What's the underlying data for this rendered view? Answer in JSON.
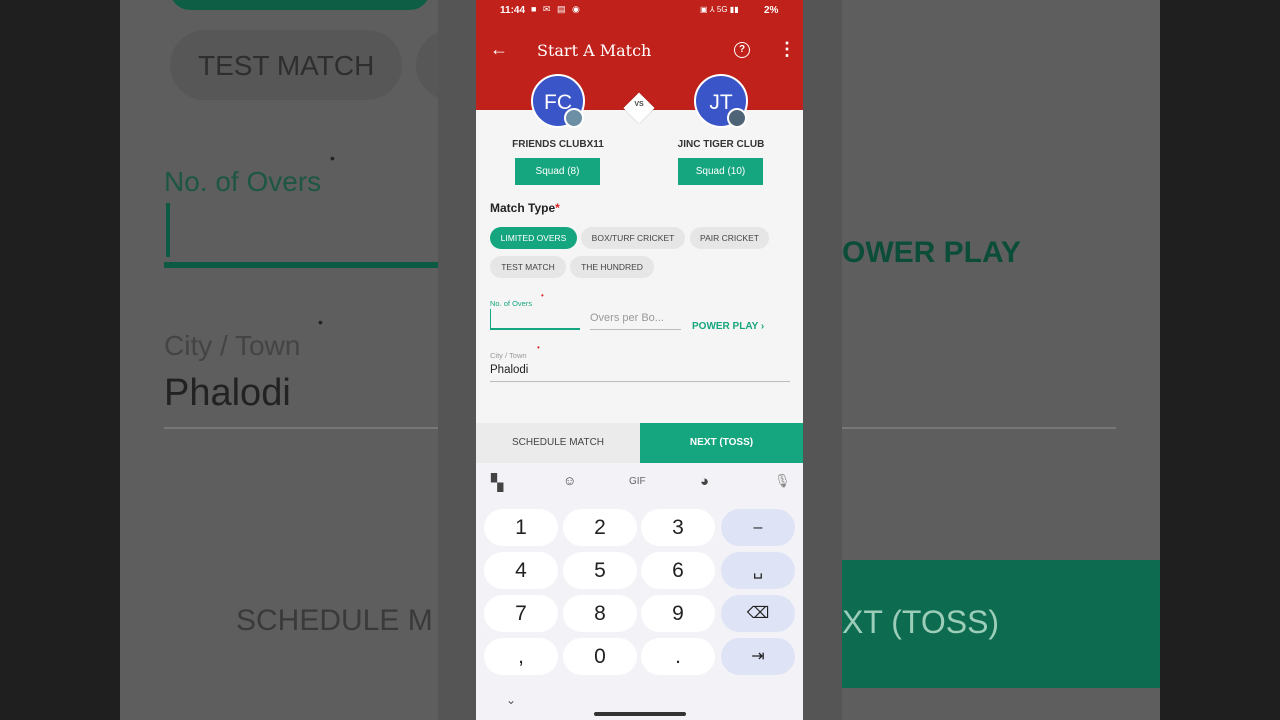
{
  "background": {
    "test_match": "TEST MATCH",
    "no_of_overs": "No. of Overs",
    "city_town": "City / Town",
    "city_value": "Phalodi",
    "power_play": "OWER PLAY",
    "schedule": "SCHEDULE M",
    "next_toss": "XT (TOSS)"
  },
  "status_bar": {
    "time": "11:44",
    "battery": "2%"
  },
  "header": {
    "title": "Start A Match"
  },
  "team_a": {
    "initials": "FC",
    "name": "FRIENDS CLUBX11",
    "squad_label": "Squad (8)"
  },
  "vs_label": "VS",
  "team_b": {
    "initials": "JT",
    "name": "JINC TIGER CLUB",
    "squad_label": "Squad (10)"
  },
  "match_type": {
    "label": "Match Type",
    "required_mark": "*",
    "options": [
      "LIMITED OVERS",
      "BOX/TURF CRICKET",
      "PAIR CRICKET",
      "TEST MATCH",
      "THE HUNDRED"
    ],
    "selected": "LIMITED OVERS"
  },
  "form": {
    "overs_label": "No. of Overs",
    "overs_value": "",
    "overs_per_bowler_placeholder": "Overs per Bo...",
    "power_play_label": "POWER PLAY",
    "city_label": "City / Town",
    "city_value": "Phalodi"
  },
  "actions": {
    "schedule": "SCHEDULE MATCH",
    "next": "NEXT (TOSS)"
  },
  "keyboard": {
    "toolbar": [
      "apps-icon",
      "sticker-icon",
      "GIF",
      "palette-icon",
      "mic-icon"
    ],
    "gif_label": "GIF",
    "keys": {
      "k1": "1",
      "k2": "2",
      "k3": "3",
      "minus": "–",
      "k4": "4",
      "k5": "5",
      "k6": "6",
      "space": "␣",
      "k7": "7",
      "k8": "8",
      "k9": "9",
      "backspace": "⌫",
      "comma": ",",
      "k0": "0",
      "dot": ".",
      "tab": "⇥"
    }
  },
  "colors": {
    "brand_red": "#c0211a",
    "accent_green": "#16a67f",
    "avatar_blue": "#3a55c8"
  }
}
